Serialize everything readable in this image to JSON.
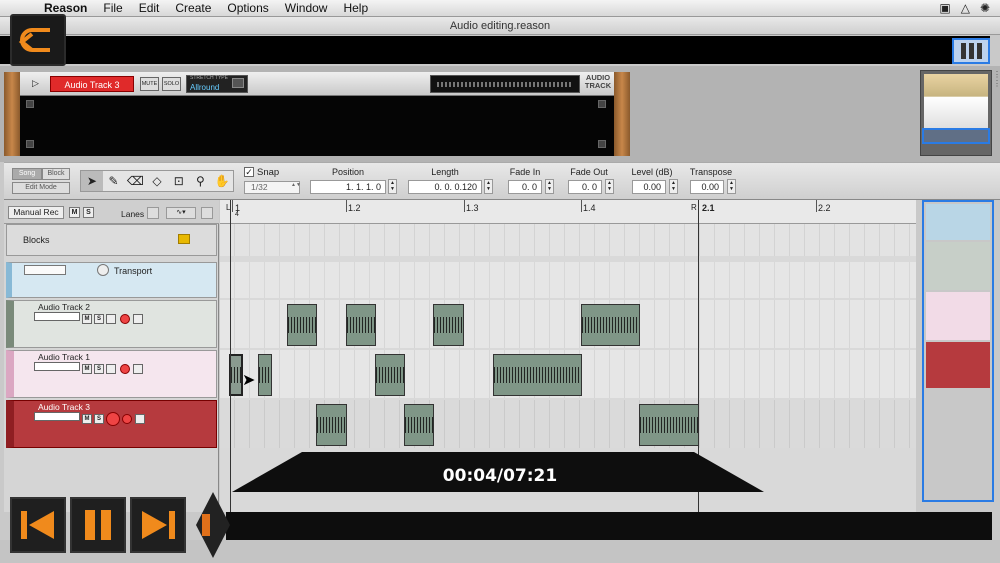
{
  "menubar": {
    "app": "Reason",
    "items": [
      "File",
      "Edit",
      "Create",
      "Options",
      "Window",
      "Help"
    ]
  },
  "window": {
    "title": "Audio editing.reason"
  },
  "rack": {
    "track_name": "Audio Track 3",
    "mute": "MUTE",
    "solo": "SOLO",
    "patch_label": "STRETCH TYPE",
    "patch_value": "Allround",
    "device_label": "AUDIO TRACK"
  },
  "toolbar": {
    "mode_song": "Song",
    "mode_block": "Block",
    "edit_mode": "Edit Mode",
    "snap_label": "Snap",
    "snap_checked": "✓",
    "snap_value": "1/32",
    "fields": [
      {
        "label": "Position",
        "value": "1.  1.  1.    0"
      },
      {
        "label": "Length",
        "value": "0.  0.  0.120"
      },
      {
        "label": "Fade In",
        "value": "0.    0"
      },
      {
        "label": "Fade Out",
        "value": "0.    0"
      },
      {
        "label": "Level (dB)",
        "value": "0.00"
      },
      {
        "label": "Transpose",
        "value": "0.00"
      }
    ]
  },
  "sequencer": {
    "manual_rec": "Manual Rec",
    "m": "M",
    "s": "S",
    "lanes_label": "Lanes",
    "blocks_label": "Blocks",
    "transport_label": "Transport",
    "tracks": [
      {
        "name": "Audio Track 2"
      },
      {
        "name": "Audio Track 1"
      },
      {
        "name": "Audio Track 3"
      }
    ],
    "ruler": {
      "bars": [
        "1",
        "1.2",
        "1.3",
        "1.4",
        "2.1",
        "2.2"
      ],
      "left_marker": "L",
      "right_marker": "R",
      "sub": "4"
    }
  },
  "video": {
    "timecode": "00:04/07:21"
  }
}
